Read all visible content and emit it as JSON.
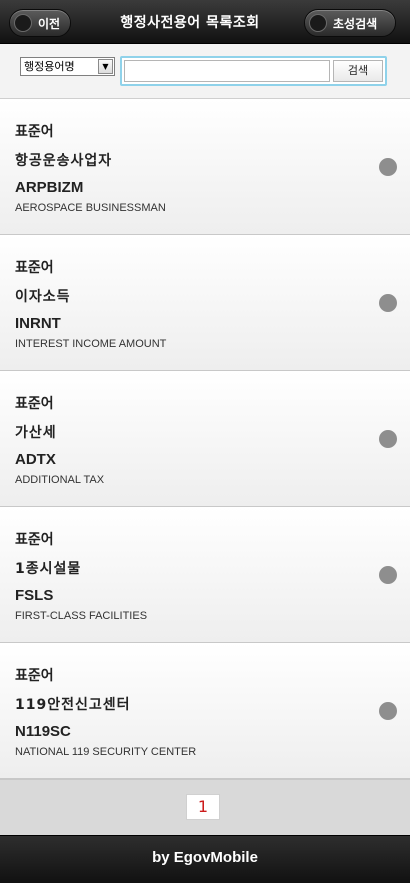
{
  "header": {
    "title": "행정사전용어 목록조회",
    "back_label": "이전",
    "initial_search_label": "초성검색"
  },
  "search": {
    "select_value": "행정용어명",
    "input_value": "",
    "button_label": "검색"
  },
  "items": [
    {
      "type": "표준어",
      "term": "항공운송사업자",
      "abbr": "ARPBIZM",
      "english": "AEROSPACE BUSINESSMAN"
    },
    {
      "type": "표준어",
      "term": "이자소득",
      "abbr": "INRNT",
      "english": "INTEREST INCOME AMOUNT"
    },
    {
      "type": "표준어",
      "term": "가산세",
      "abbr": "ADTX",
      "english": "ADDITIONAL TAX"
    },
    {
      "type": "표준어",
      "term": "1종시설물",
      "abbr": "FSLS",
      "english": "FIRST-CLASS FACILITIES"
    },
    {
      "type": "표준어",
      "term": "119안전신고센터",
      "abbr": "N119SC",
      "english": "NATIONAL 119 SECURITY CENTER"
    }
  ],
  "pagination": {
    "current_page": "1"
  },
  "footer": {
    "text": "by EgovMobile"
  }
}
